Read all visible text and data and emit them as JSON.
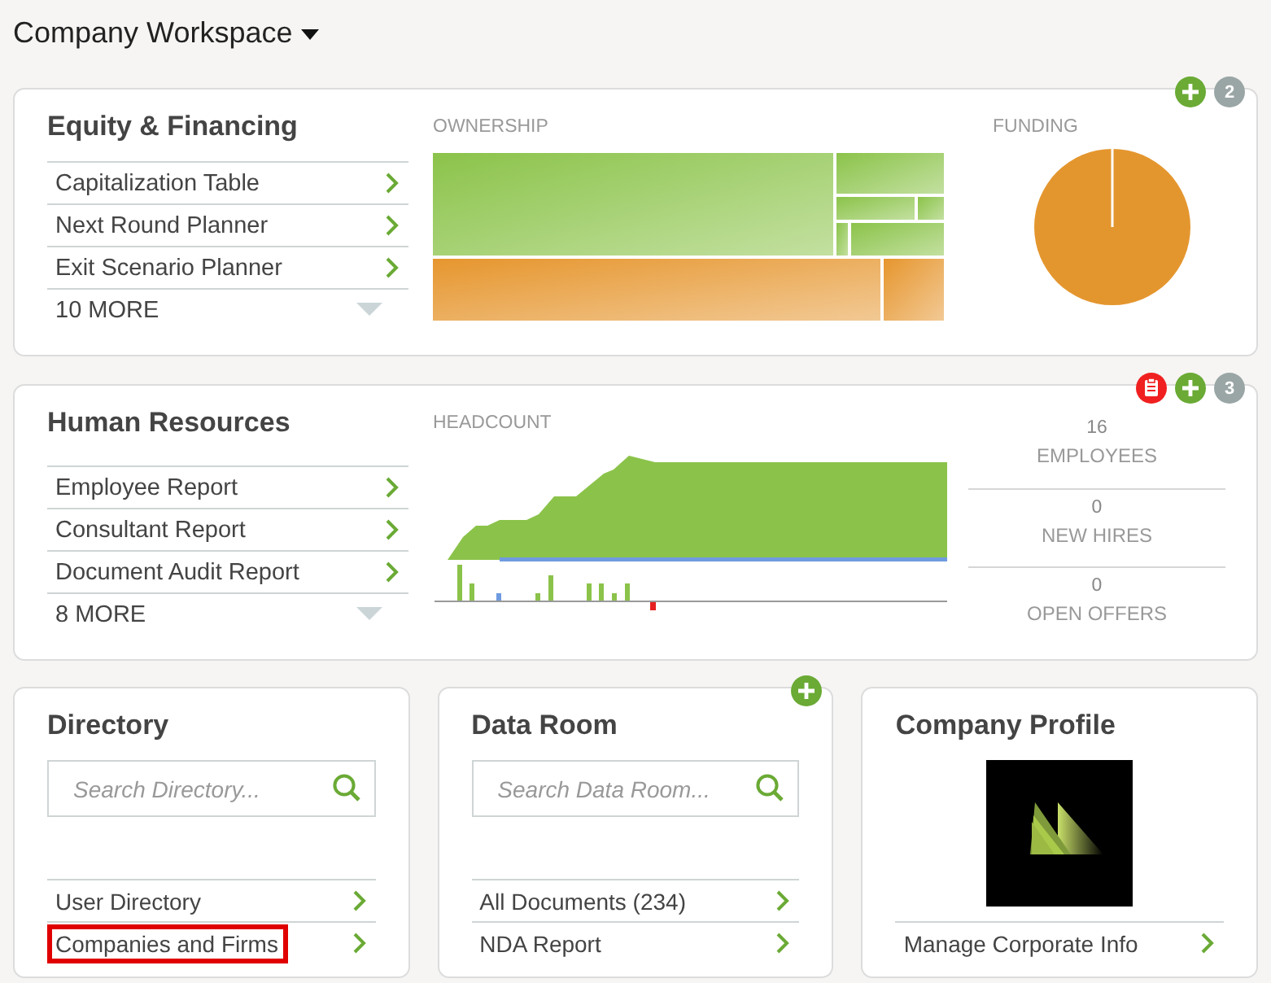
{
  "header": {
    "title": "Company Workspace"
  },
  "equity": {
    "title": "Equity & Financing",
    "badge_count": "2",
    "links": [
      {
        "label": "Capitalization Table"
      },
      {
        "label": "Next Round Planner"
      },
      {
        "label": "Exit Scenario Planner"
      }
    ],
    "more": "10 MORE",
    "ownership_label": "OWNERSHIP",
    "funding_label": "FUNDING"
  },
  "hr": {
    "title": "Human Resources",
    "badge_count": "3",
    "links": [
      {
        "label": "Employee Report"
      },
      {
        "label": "Consultant Report"
      },
      {
        "label": "Document Audit Report"
      }
    ],
    "more": "8 MORE",
    "headcount_label": "HEADCOUNT",
    "stats": [
      {
        "value": "16",
        "label": "EMPLOYEES"
      },
      {
        "value": "0",
        "label": "NEW HIRES"
      },
      {
        "value": "0",
        "label": "OPEN OFFERS"
      }
    ]
  },
  "directory": {
    "title": "Directory",
    "search": {
      "placeholder": "Search Directory..."
    },
    "links": [
      {
        "label": "User Directory",
        "highlighted": false
      },
      {
        "label": "Companies and Firms",
        "highlighted": true
      }
    ]
  },
  "data_room": {
    "title": "Data Room",
    "search": {
      "placeholder": "Search Data Room..."
    },
    "links": [
      {
        "label": "All Documents (234)"
      },
      {
        "label": "NDA Report"
      }
    ]
  },
  "profile": {
    "title": "Company Profile",
    "links": [
      {
        "label": "Manage Corporate Info"
      }
    ]
  }
}
